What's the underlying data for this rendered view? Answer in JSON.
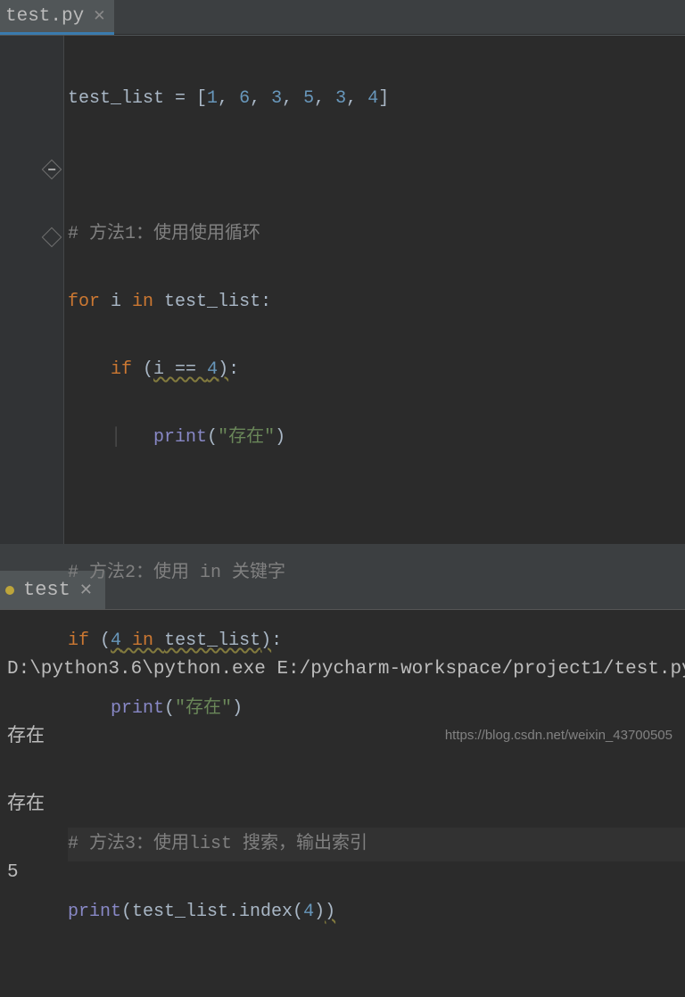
{
  "tab": {
    "filename": "test.py"
  },
  "code": {
    "assign_left": "test_list = [",
    "nums": [
      "1",
      "6",
      "3",
      "5",
      "3",
      "4"
    ],
    "assign_right": "]",
    "c1": "# 方法1：使用使用循环",
    "for_kw": "for",
    "for_var": " i ",
    "in_kw": "in",
    "for_rest": " test_list:",
    "if_kw": "if",
    "cond_open": " (",
    "cond": "i == ",
    "cond_num": "4",
    "cond_close": "):",
    "print": "print",
    "p_open": "(",
    "s_exist": "\"存在\"",
    "p_close": ")",
    "c2": "# 方法2：使用 in 关键字",
    "if2_open": " (",
    "if2_num": "4",
    "if2_in": " in ",
    "if2_rest": "test_list",
    "if2_close": "):",
    "c3": "# 方法3：使用list 搜索，输出索引",
    "idx_call": "test_list.index(",
    "idx_num": "4",
    "idx_close": ")"
  },
  "run": {
    "name": "test",
    "cmd": "D:\\python3.6\\python.exe E:/pycharm-workspace/project1/test.py",
    "out1": "存在",
    "out2": "存在",
    "out3": "5"
  },
  "watermark": "https://blog.csdn.net/weixin_43700505"
}
